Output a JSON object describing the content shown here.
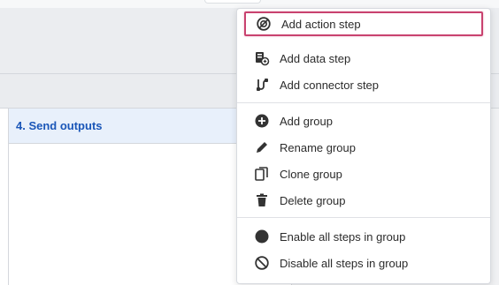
{
  "column": {
    "title": "4. Send outputs"
  },
  "menu": {
    "items": [
      {
        "label": "Add action step",
        "icon": "action-step-icon"
      },
      {
        "label": "Add data step",
        "icon": "data-step-icon"
      },
      {
        "label": "Add connector step",
        "icon": "connector-step-icon"
      },
      {
        "label": "Add group",
        "icon": "add-circle-icon"
      },
      {
        "label": "Rename group",
        "icon": "pencil-icon"
      },
      {
        "label": "Clone group",
        "icon": "copy-icon"
      },
      {
        "label": "Delete group",
        "icon": "trash-icon"
      },
      {
        "label": "Enable all steps in group",
        "icon": "filled-circle-icon"
      },
      {
        "label": "Disable all steps in group",
        "icon": "disabled-circle-icon"
      }
    ],
    "highlighted": "Add action step"
  },
  "colors": {
    "accent_text": "#1a56b8",
    "highlight_border": "#c9426f"
  }
}
